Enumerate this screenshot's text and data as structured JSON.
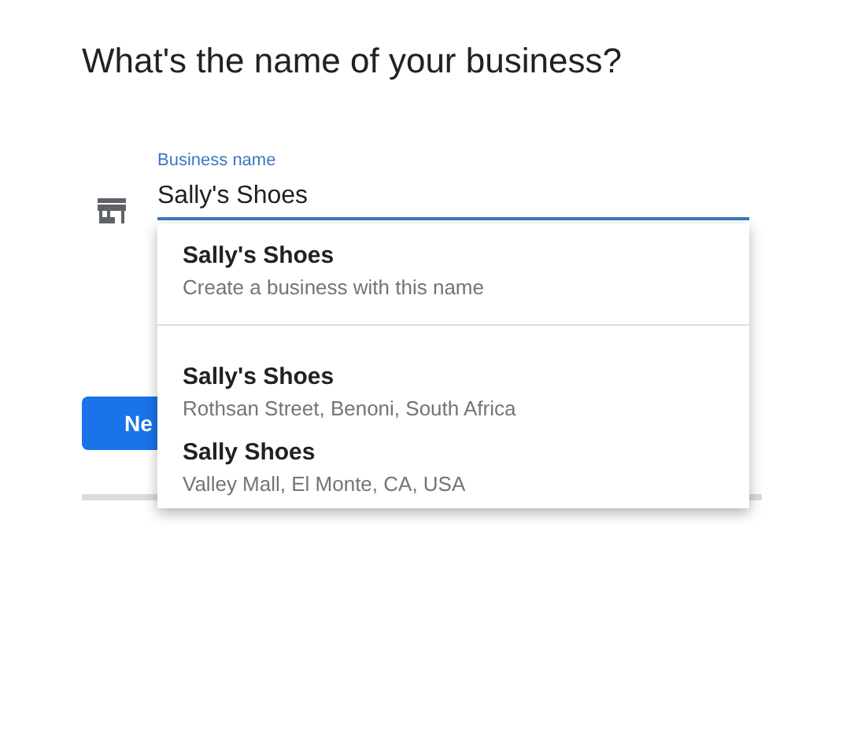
{
  "heading": "What's the name of your business?",
  "field": {
    "label": "Business name",
    "value": "Sally's Shoes"
  },
  "suggestions": [
    {
      "name": "Sally's Shoes",
      "detail": "Create a business with this name",
      "kind": "create"
    },
    {
      "name": "Sally's Shoes",
      "detail": "Rothsan Street, Benoni, South Africa",
      "kind": "place"
    },
    {
      "name": "Sally Shoes",
      "detail": "Valley Mall, El Monte, CA, USA",
      "kind": "place"
    }
  ],
  "button": "Ne"
}
